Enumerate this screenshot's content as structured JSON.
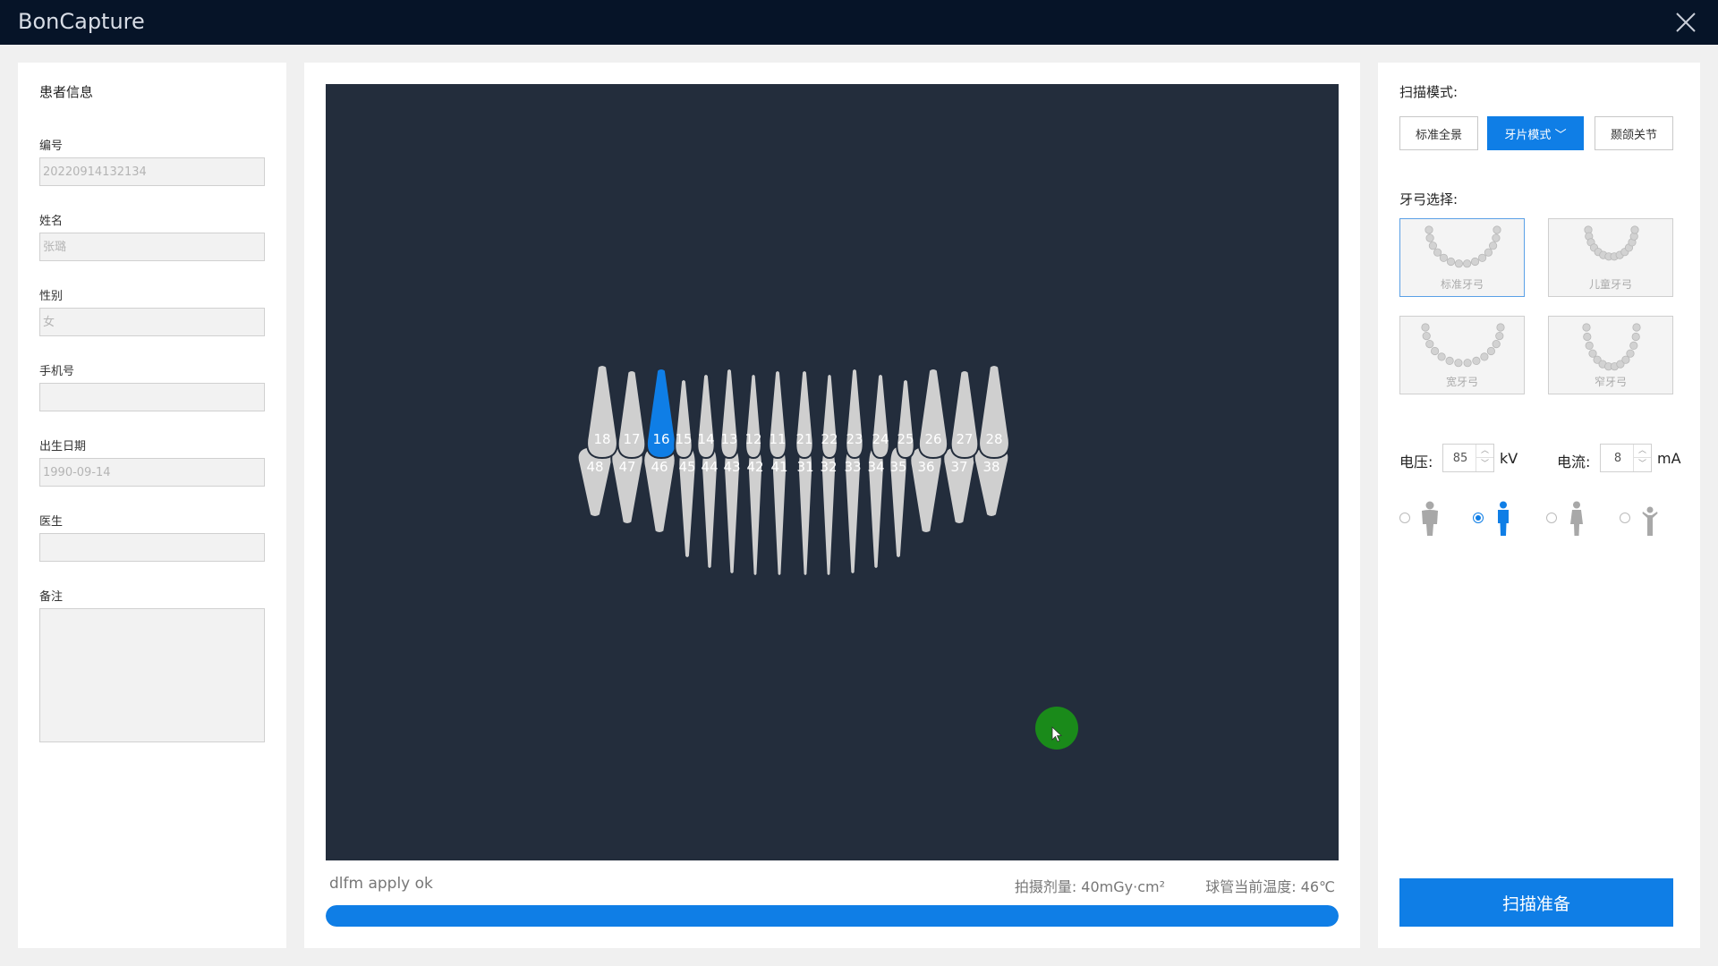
{
  "app": {
    "title": "BonCapture"
  },
  "patient": {
    "heading": "患者信息",
    "fields": [
      {
        "label": "编号",
        "value": "",
        "placeholder": "20220914132134"
      },
      {
        "label": "姓名",
        "value": "",
        "placeholder": "张璐"
      },
      {
        "label": "性别",
        "value": "",
        "placeholder": "女"
      },
      {
        "label": "手机号",
        "value": "",
        "placeholder": ""
      },
      {
        "label": "出生日期",
        "value": "",
        "placeholder": "1990-09-14"
      },
      {
        "label": "医生",
        "value": "",
        "placeholder": ""
      }
    ],
    "notes": {
      "label": "备注",
      "value": ""
    }
  },
  "viewer": {
    "selected_tooth": "16",
    "upper_teeth": [
      "18",
      "17",
      "16",
      "15",
      "14",
      "13",
      "12",
      "11",
      "21",
      "22",
      "23",
      "24",
      "25",
      "26",
      "27",
      "28"
    ],
    "lower_teeth": [
      "48",
      "47",
      "46",
      "45",
      "44",
      "43",
      "42",
      "41",
      "31",
      "32",
      "33",
      "34",
      "35",
      "36",
      "37",
      "38"
    ],
    "status_message": "dlfm apply ok",
    "dose_text": "拍摄剂量: 40mGy·cm²",
    "temperature_text": "球管当前温度: 46℃",
    "progress": 1.0
  },
  "scan": {
    "mode_heading": "扫描模式:",
    "modes": [
      {
        "label": "标准全景",
        "active": false
      },
      {
        "label": "牙片模式",
        "active": true
      },
      {
        "label": "颞颌关节",
        "active": false
      }
    ],
    "arch_heading": "牙弓选择:",
    "arches": [
      {
        "label": "标准牙弓",
        "selected": true
      },
      {
        "label": "儿童牙弓",
        "selected": false
      },
      {
        "label": "宽牙弓",
        "selected": false
      },
      {
        "label": "窄牙弓",
        "selected": false
      }
    ],
    "voltage_label": "电压:",
    "voltage_value": "85",
    "voltage_unit": "kV",
    "current_label": "电流:",
    "current_value": "8",
    "current_unit": "mA",
    "body_types": [
      {
        "icon": "large-adult-icon",
        "selected": false
      },
      {
        "icon": "adult-icon",
        "selected": true
      },
      {
        "icon": "small-adult-icon",
        "selected": false
      },
      {
        "icon": "child-icon",
        "selected": false
      }
    ],
    "prepare_button": "扫描准备"
  },
  "colors": {
    "accent": "#0f7ee6",
    "titlebar": "#061428",
    "viewer_bg": "#232d3c",
    "tooth": "#cfcfcf",
    "tooth_selected": "#0f7ee6"
  }
}
